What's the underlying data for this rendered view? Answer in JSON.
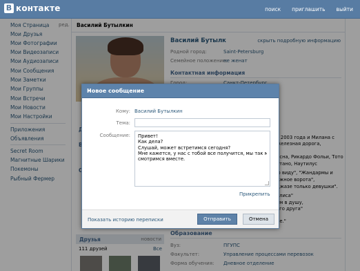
{
  "header": {
    "logo_letter": "В",
    "logo_text": "контакте",
    "nav": [
      "поиск",
      "приглашить",
      "выйти"
    ]
  },
  "sidebar": {
    "edit": "ред.",
    "items": [
      "Моя Страница",
      "Мои Друзья",
      "Мои Фотографии",
      "Мои Видеозаписи",
      "Мои Аудиозаписи",
      "Мои Сообщения",
      "Мои Заметки",
      "Мои Группы",
      "Мои Встречи",
      "Мои Новости",
      "Мои Настройки"
    ],
    "apps": [
      "Приложения",
      "Объявления"
    ],
    "games": [
      "Secret Room",
      "Магнитные Шарики",
      "Покемоны",
      "Рыбный Фермер"
    ]
  },
  "profile": {
    "header_name": "Василий Бутылкин",
    "name": "Василий Бутылк",
    "hide_link": "скрыть подробную информацию",
    "rows": [
      {
        "label": "Родной город:",
        "value": "Saint-Petersburg"
      },
      {
        "label": "Семейное положение:",
        "value": "не женат"
      }
    ],
    "contact_section": "Контактная информация",
    "contact_partial": "Город:",
    "contact_partial_value": "Санкт-Петербург",
    "bio_lines": [
      "с 2003 года и Милана с",
      "железная дорога,",
      "ь",
      "лсна, Рикардо Фольи, Тото",
      "отано, Наутилус",
      "ю виду\", \"Жандармы и",
      "ажное ворота\",",
      "джазе только девушки\".",
      "олиса\"",
      "ем в душу,",
      "ого друга\"",
      "ие.\""
    ],
    "left_stubs": [
      "Д",
      "В",
      "О"
    ],
    "friends": {
      "title": "Друзья",
      "right": "новости",
      "count": "111 друзей",
      "all": "Все"
    },
    "education": {
      "title": "Образование",
      "rows": [
        {
          "label": "Вуз:",
          "value": "ПГУПС"
        },
        {
          "label": "Факультет:",
          "value": "Управление процессами перевозок"
        },
        {
          "label": "Форма обучения:",
          "value": "Дневное отделение"
        }
      ]
    }
  },
  "modal": {
    "title": "Новое сообщение",
    "close": "✕",
    "to_label": "Кому:",
    "to_value": "Василий Бутылкин",
    "subject_label": "Тема:",
    "subject_value": "",
    "message_label": "Сообщение:",
    "message_lines": [
      "Привет!",
      "Как дела?",
      "Слушай, может встретимся сегодня?",
      "Мне кажется, у нас с тобой все получится, мы так мило",
      "смотримся вместе."
    ],
    "attach": "Прикрепить",
    "history": "Показать историю переписки",
    "send": "Отправить",
    "cancel": "Отмена"
  },
  "colors": {
    "header": "#587ca3",
    "link": "#2b587a",
    "modal_title": "#5d83ab",
    "send_button": "#5e82a8"
  }
}
